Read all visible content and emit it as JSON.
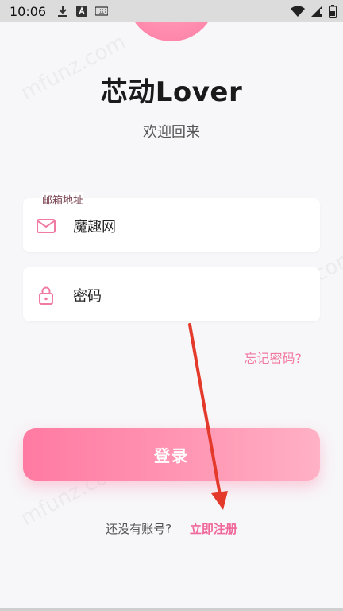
{
  "status_bar": {
    "time": "10:06",
    "icons": [
      "download-icon",
      "a-box-icon",
      "keyboard-icon",
      "wifi-icon",
      "signal-icon",
      "battery-icon"
    ]
  },
  "app": {
    "title": "芯动Lover",
    "subtitle": "欢迎回来"
  },
  "email_field": {
    "label": "邮箱地址",
    "value": "魔趣网",
    "icon": "mail-icon"
  },
  "password_field": {
    "placeholder": "密码",
    "icon": "lock-icon"
  },
  "forgot_password": "忘记密码?",
  "login_button": "登录",
  "register": {
    "prompt": "还没有账号?",
    "link": "立即注册"
  },
  "watermark": "mfunz.com",
  "colors": {
    "accent": "#f17aa1",
    "button_start": "#ff7aa2",
    "button_end": "#ffb1c5",
    "annotation_arrow": "#e43a2c"
  }
}
